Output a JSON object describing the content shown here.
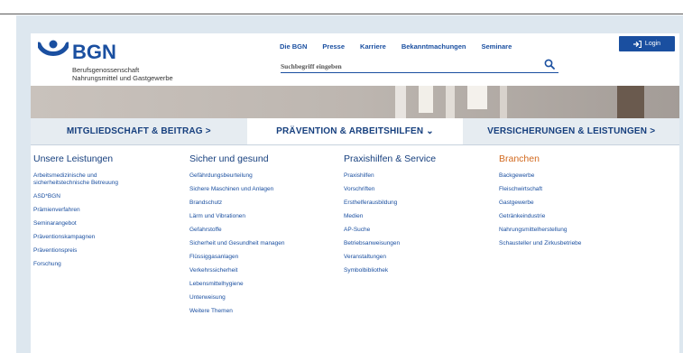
{
  "brand": {
    "name": "BGN",
    "subtitle_line1": "Berufsgenossenschaft",
    "subtitle_line2": "Nahrungsmittel und Gastgewerbe",
    "color": "#1a4fa0"
  },
  "topnav": [
    "Die BGN",
    "Presse",
    "Karriere",
    "Bekanntmachungen",
    "Seminare"
  ],
  "search": {
    "placeholder": "Suchbegriff eingeben"
  },
  "login": {
    "label": "Login",
    "icon": "login-arrow-icon"
  },
  "mainnav": {
    "tabs": [
      {
        "label": "MITGLIEDSCHAFT & BEITRAG >",
        "active": false
      },
      {
        "label": "PRÄVENTION & ARBEITSHILFEN ⌄",
        "active": true
      },
      {
        "label": "VERSICHERUNGEN & LEISTUNGEN >",
        "active": false
      }
    ]
  },
  "menu": {
    "columns": [
      {
        "heading": "Unsere Leistungen",
        "items": [
          "Arbeitsmedizinische und",
          "sicherheitstechnische Betreuung",
          "ASD*BGN",
          "Prämienverfahren",
          "Seminarangebot",
          "Präventionskampagnen",
          "Präventionspreis",
          "Forschung"
        ]
      },
      {
        "heading": "Sicher und gesund",
        "items": [
          "Gefährdungsbeurteilung",
          "Sichere Maschinen und Anlagen",
          "Brandschutz",
          "Lärm und Vibrationen",
          "Gefahrstoffe",
          "Sicherheit und Gesundheit managen",
          "Flüssiggasanlagen",
          "Verkehrssicherheit",
          "Lebensmittelhygiene",
          "Unterweisung",
          "Weitere Themen"
        ]
      },
      {
        "heading": "Praxishilfen & Service",
        "items": [
          "Praxishilfen",
          "Vorschriften",
          "Ersthelferausbildung",
          "Medien",
          "AP-Suche",
          "Betriebsanweisungen",
          "Veranstaltungen",
          "Symbolbibliothek"
        ]
      },
      {
        "heading": "Branchen",
        "accent": "#d2691e",
        "items": [
          "Backgewerbe",
          "Fleischwirtschaft",
          "Gastgewerbe",
          "Getränkeindustrie",
          "Nahrungsmittelherstellung",
          "Schausteller und Zirkusbetriebe"
        ]
      }
    ]
  }
}
